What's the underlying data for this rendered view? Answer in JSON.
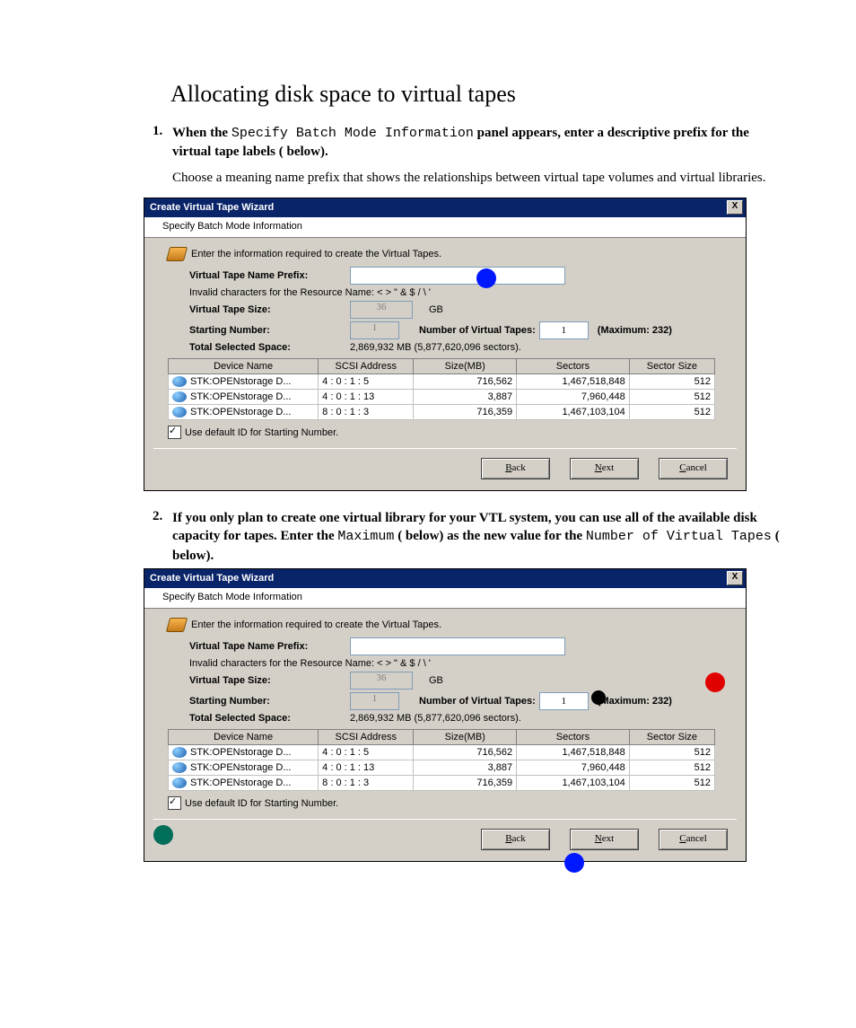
{
  "heading": "Allocating disk space to virtual tapes",
  "step1": {
    "num": "1.",
    "pre": "When the ",
    "mono": "Specify Batch Mode Information",
    "post": " panel appears, enter a descriptive prefix for the virtual tape labels (   below).",
    "follow": "Choose a meaning name prefix that shows the relationships between virtual tape volumes and virtual libraries."
  },
  "step2": {
    "num": "2.",
    "t1": "If you only plan to create one virtual library for your VTL system, you can use all of the available disk capacity for tapes. Enter the ",
    "mono1": "Maximum",
    "t2": " (   below) as the new value for the ",
    "mono2": "Number of Virtual Tapes",
    "t3": " (   below)."
  },
  "wiz": {
    "title": "Create Virtual Tape Wizard",
    "x": "X",
    "sub": "Specify Batch Mode Information",
    "intro": "Enter the information required to create the Virtual Tapes.",
    "prefix_lbl": "Virtual Tape Name Prefix:",
    "invalid": "Invalid characters for the Resource Name: < > \" & $ / \\ '",
    "size_lbl": "Virtual Tape Size:",
    "size_val": "36",
    "size_unit": "GB",
    "start_lbl": "Starting Number:",
    "start_val": "1",
    "num_lbl": "Number of Virtual Tapes:",
    "num_val": "1",
    "max": "(Maximum: 232)",
    "total_lbl": "Total Selected Space:",
    "total_val": "2,869,932 MB (5,877,620,096 sectors).",
    "cols": {
      "c1": "Device Name",
      "c2": "SCSI Address",
      "c3": "Size(MB)",
      "c4": "Sectors",
      "c5": "Sector Size"
    },
    "rows": [
      {
        "name": "STK:OPENstorage D...",
        "scsi": "4 : 0 : 1 : 5",
        "size": "716,562",
        "sectors": "1,467,518,848",
        "ss": "512"
      },
      {
        "name": "STK:OPENstorage D...",
        "scsi": "4 : 0 : 1 : 13",
        "size": "3,887",
        "sectors": "7,960,448",
        "ss": "512"
      },
      {
        "name": "STK:OPENstorage D...",
        "scsi": "8 : 0 : 1 : 3",
        "size": "716,359",
        "sectors": "1,467,103,104",
        "ss": "512"
      }
    ],
    "chk": "Use default ID for Starting Number.",
    "back": "Back",
    "next": "Next",
    "cancel": "Cancel"
  }
}
